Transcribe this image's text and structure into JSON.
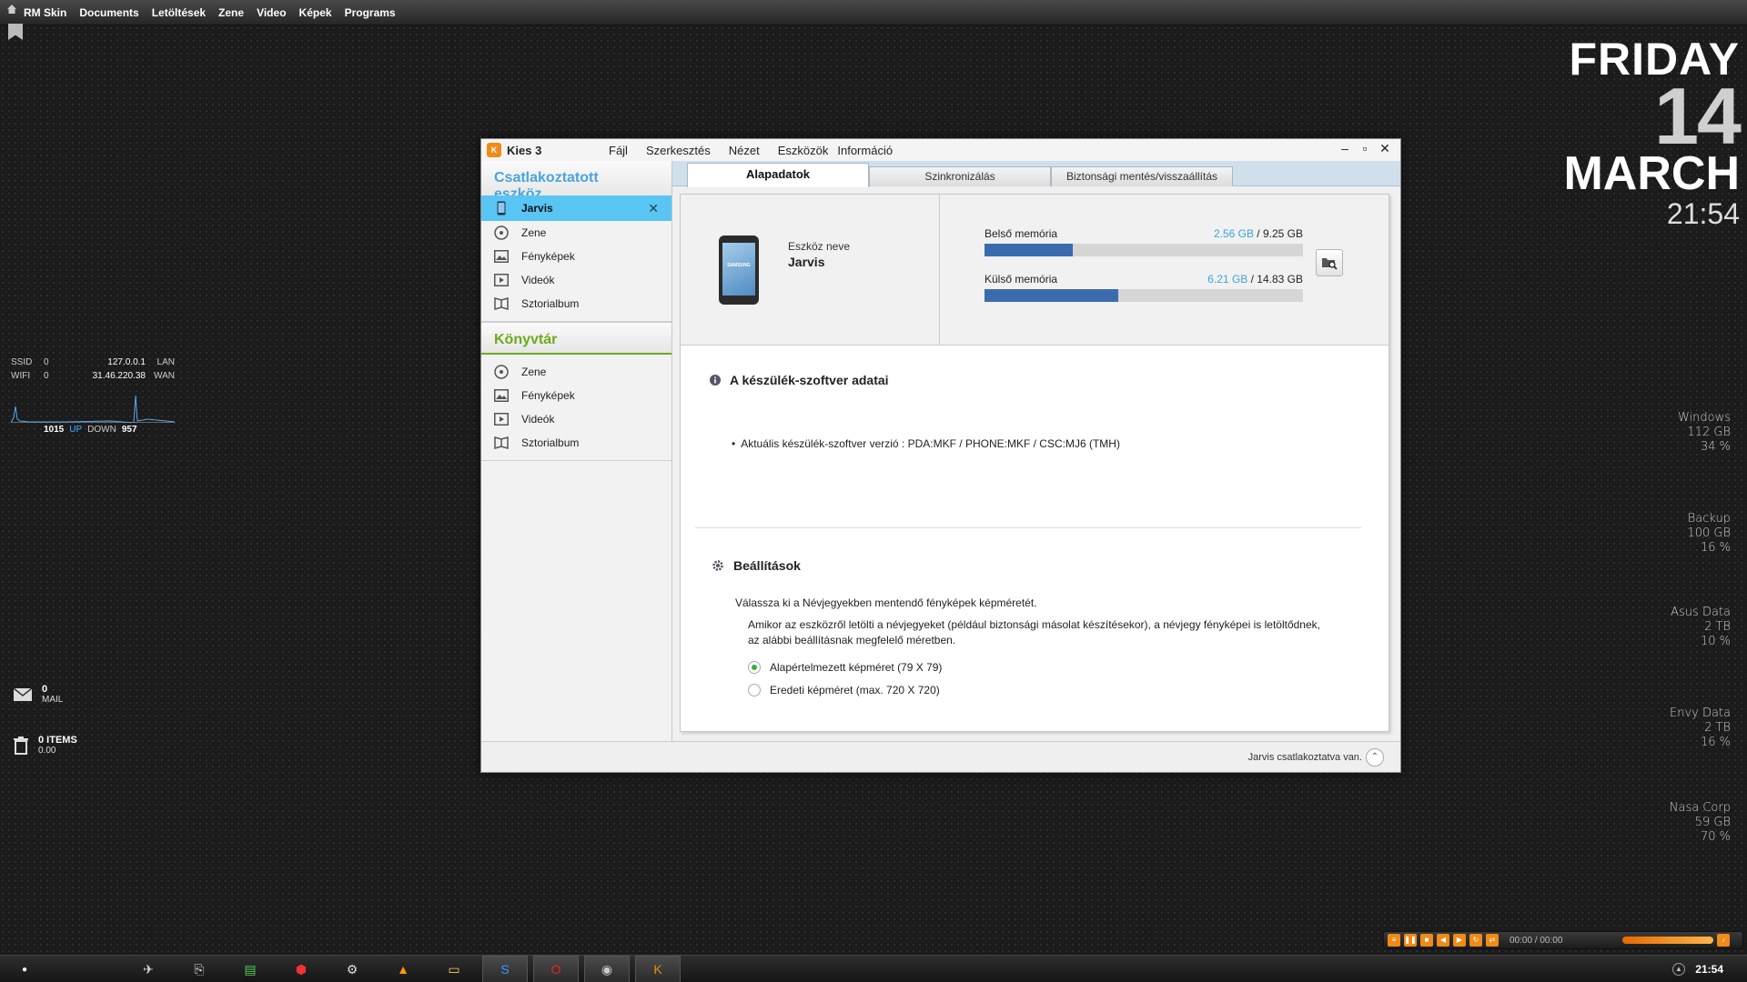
{
  "topbar": {
    "items": [
      "RM Skin",
      "Documents",
      "Letöltések",
      "Zene",
      "Video",
      "Képek",
      "Programs"
    ]
  },
  "datewidget": {
    "day": "FRIDAY",
    "date": "14",
    "month": "MARCH",
    "time": "21:54"
  },
  "network": {
    "ssid_label": "SSID",
    "ssid_value": "0",
    "lan_ip": "127.0.0.1",
    "lan_label": "LAN",
    "wifi_label": "WIFI",
    "wifi_value": "0",
    "wan_ip": "31.46.220.38",
    "wan_label": "WAN",
    "up_value": "1015",
    "up_label": "UP",
    "down_label": "DOWN",
    "down_value": "957"
  },
  "mail": {
    "count": "0",
    "label": "MAIL"
  },
  "recycle": {
    "items": "0 ITEMS",
    "size": "0.00"
  },
  "drives": [
    {
      "name": "Windows",
      "size": "112 GB",
      "percent": "34 %"
    },
    {
      "name": "Backup",
      "size": "100 GB",
      "percent": "16 %"
    },
    {
      "name": "Asus Data",
      "size": "2 TB",
      "percent": "10 %"
    },
    {
      "name": "Envy Data",
      "size": "2 TB",
      "percent": "16 %"
    },
    {
      "name": "Nasa Corp",
      "size": "59 GB",
      "percent": "70 %"
    }
  ],
  "window": {
    "title": "Kies 3",
    "menu": [
      "Fájl",
      "Szerkesztés",
      "Nézet",
      "Eszközök",
      "Információ"
    ],
    "sidebar": {
      "connected_header": "Csatlakoztatott eszköz...",
      "device": "Jarvis",
      "device_items": [
        "Zene",
        "Fényképek",
        "Videók",
        "Sztorialbum"
      ],
      "library_header": "Könyvtár",
      "library_items": [
        "Zene",
        "Fényképek",
        "Videók",
        "Sztorialbum"
      ]
    },
    "tabs": [
      "Alapadatok",
      "Szinkronizálás",
      "Biztonsági mentés/visszaállítás"
    ],
    "device": {
      "name_label": "Eszköz neve",
      "name": "Jarvis",
      "phone_brand": "SAMSUNG",
      "internal_label": "Belső memória",
      "internal_used": "2.56 GB",
      "internal_total": " / 9.25 GB",
      "internal_fraction": 0.277,
      "external_label": "Külső memória",
      "external_used": "6.21 GB",
      "external_total": " / 14.83 GB",
      "external_fraction": 0.419
    },
    "firmware": {
      "title": "A készülék-szoftver adatai",
      "line": "Aktuális készülék-szoftver verzió : PDA:MKF / PHONE:MKF / CSC:MJ6 (TMH)"
    },
    "settings": {
      "title": "Beállítások",
      "prompt": "Válassza ki a Névjegyekben mentendő fényképek képméretét.",
      "description": "Amikor az eszközről letölti a névjegyeket (például biztonsági másolat készítésekor), a névjegy fényképei is letöltődnek, az alábbi beállításnak megfelelő méretben.",
      "option_default": "Alapértelmezett képméret (79 X 79)",
      "option_original": "Eredeti képméret (max. 720 X 720)",
      "selected": "default"
    },
    "status": "Jarvis csatlakoztatva van."
  },
  "player": {
    "time": "00:00 / 00:00"
  },
  "taskbar": {
    "clock": "21:54"
  },
  "colors": {
    "accent_blue": "#58c5f3",
    "library_green": "#6bab1e",
    "memory_bar": "#3a6cad",
    "kies_orange": "#f08a18"
  }
}
